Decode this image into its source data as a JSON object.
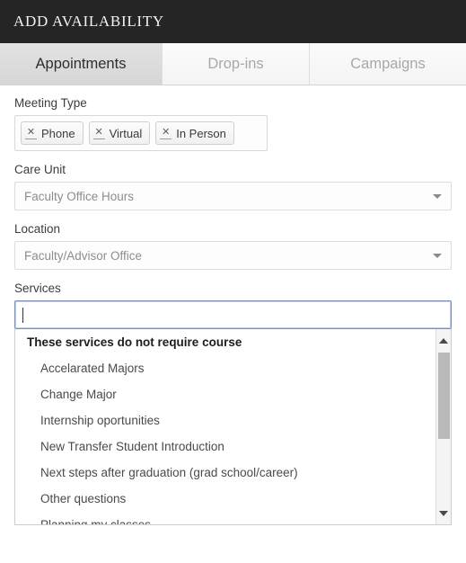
{
  "header": {
    "title": "ADD AVAILABILITY",
    "background_color": "#252525",
    "title_color": "#f2f2f2"
  },
  "tabs": [
    {
      "label": "Appointments",
      "active": true
    },
    {
      "label": "Drop-ins",
      "active": false
    },
    {
      "label": "Campaigns",
      "active": false
    }
  ],
  "form": {
    "meeting_type": {
      "label": "Meeting Type",
      "chips": [
        {
          "label": "Phone",
          "remove_icon": "close-icon"
        },
        {
          "label": "Virtual",
          "remove_icon": "close-icon"
        },
        {
          "label": "In Person",
          "remove_icon": "close-icon"
        }
      ]
    },
    "care_unit": {
      "label": "Care Unit",
      "value": "Faculty Office Hours",
      "caret_icon": "chevron-down-icon"
    },
    "location": {
      "label": "Location",
      "value": "Faculty/Advisor Office",
      "caret_icon": "chevron-down-icon"
    },
    "services": {
      "label": "Services",
      "value": "",
      "focused": true,
      "focus_border_color": "#7590bb",
      "dropdown": {
        "group_label": "These services do not require course",
        "options": [
          "Accelarated Majors",
          "Change Major",
          "Internship oportunities",
          "New Transfer Student Introduction",
          "Next steps after graduation (grad school/career)",
          "Other questions",
          "Planning my classes"
        ],
        "scrollbar": {
          "up_icon": "scroll-up-arrow-icon",
          "down_icon": "scroll-down-arrow-icon"
        }
      }
    }
  }
}
